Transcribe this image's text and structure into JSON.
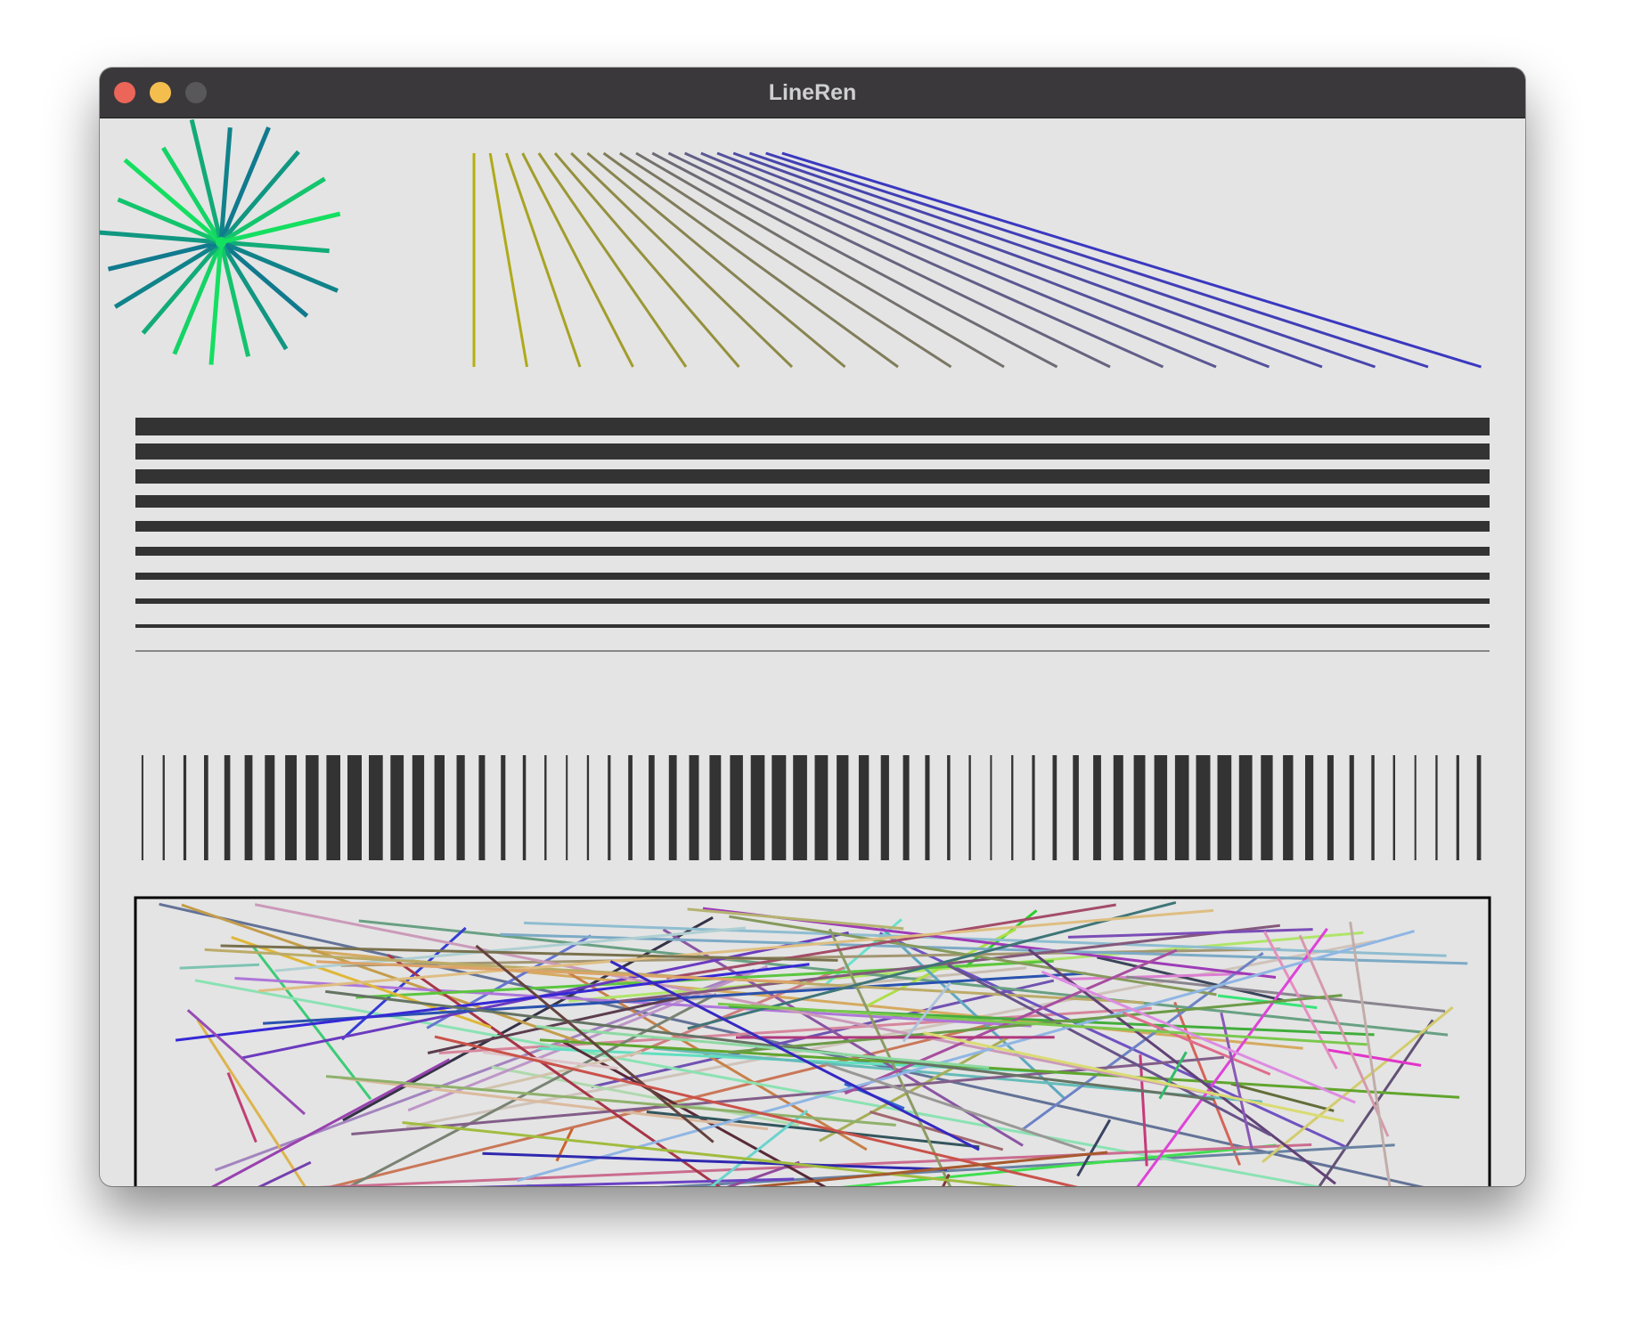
{
  "window": {
    "title": "LineRen",
    "controls": [
      "close-button",
      "minimize-button",
      "zoom-button"
    ]
  },
  "colors": {
    "titlebar": "#3a383b",
    "canvas": "#e4e4e4",
    "bars": "#333333",
    "frame": "#000000",
    "star_start": "#14e060",
    "star_end": "#10788f",
    "fan_start": "#b5b010",
    "fan_end": "#3a38c0"
  },
  "scenes": {
    "star": {
      "spokes": 20,
      "color_mode": "gradient"
    },
    "fan": {
      "lines": 20
    },
    "horizontal_lines": {
      "count": 10,
      "thickness_order": "decreasing"
    },
    "vertical_bars": {
      "count": 64,
      "pattern": "thickness-wave"
    },
    "random_lines": {
      "count": 120,
      "framed": true
    }
  }
}
